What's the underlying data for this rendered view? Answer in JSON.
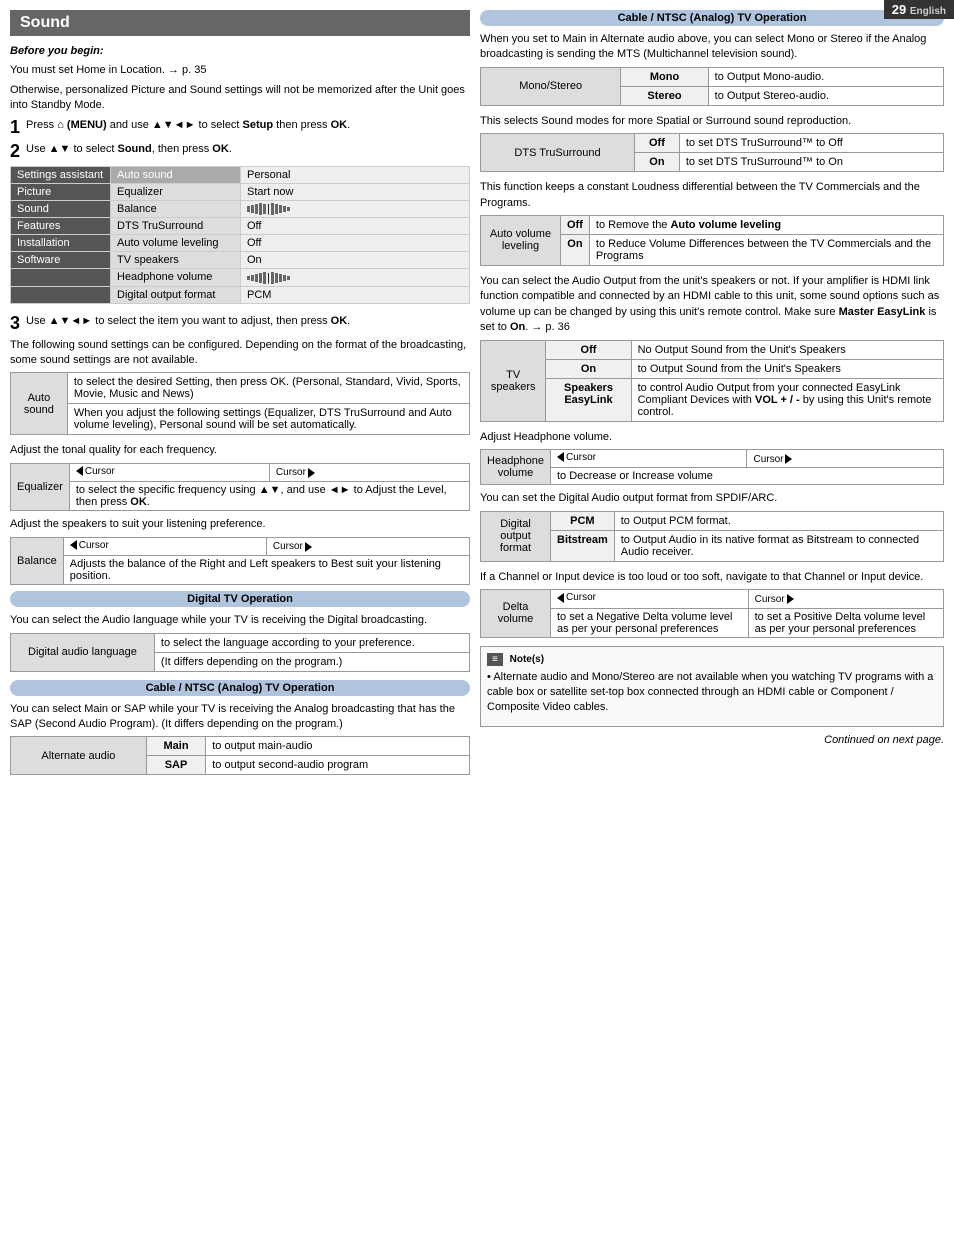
{
  "page": {
    "number": "29",
    "language": "English"
  },
  "left": {
    "heading": "Sound",
    "before_begin": "Before you begin:",
    "setup_note": "You must set Home in Location. → p. 35",
    "memorize_note": "Otherwise, personalized Picture and Sound settings will not be memorized after the Unit goes into Standby Mode.",
    "step1": "Press  (MENU) and use ▲▼◄► to select Setup then press OK.",
    "step2": "Use ▲▼ to select Sound, then press OK.",
    "settings_table": {
      "col1_header": "Settings assistant",
      "col2_header": "Auto sound",
      "col3_header": "Personal",
      "rows": [
        {
          "nav": "Picture",
          "item": "Equalizer",
          "value": "Start now"
        },
        {
          "nav": "Sound",
          "item": "Balance",
          "value": "bar"
        },
        {
          "nav": "Features",
          "item": "DTS TruSurround",
          "value": "Off"
        },
        {
          "nav": "Installation",
          "item": "Auto volume leveling",
          "value": "Off"
        },
        {
          "nav": "Software",
          "item": "TV speakers",
          "value": "On"
        },
        {
          "nav": "",
          "item": "Headphone volume",
          "value": "bar"
        },
        {
          "nav": "",
          "item": "Digital output format",
          "value": "PCM"
        }
      ]
    },
    "step3": "Use ▲▼◄► to select the item you want to adjust, then press OK.",
    "step3_note": "The following sound settings can be configured. Depending on the format of the broadcasting, some sound settings are not available.",
    "auto_sound": {
      "label": "Auto sound",
      "desc1": "to select the desired Setting, then press OK. (Personal, Standard, Vivid, Sports, Movie, Music and News)",
      "desc2": "When you adjust the following settings (Equalizer, DTS TruSurround and Auto volume leveling), Personal sound will be set automatically."
    },
    "equalizer_intro": "Adjust the tonal quality for each frequency.",
    "equalizer": {
      "label": "Equalizer",
      "cursor_left": "◄ Cursor",
      "cursor_right": "Cursor ►",
      "desc": "to select the specific frequency using ▲▼, and use ◄► to Adjust the Level, then press OK."
    },
    "balance_intro": "Adjust the speakers to suit your listening preference.",
    "balance": {
      "label": "Balance",
      "cursor_left": "◄ Cursor",
      "cursor_right": "Cursor ►",
      "desc": "Adjusts the balance of the Right and Left speakers to Best suit your listening position."
    },
    "digital_tv_banner": "Digital TV Operation",
    "digital_tv_intro": "You can select the Audio language while your TV is receiving the Digital broadcasting.",
    "digital_audio": {
      "label": "Digital audio language",
      "desc1": "to select the language according to your preference.",
      "desc2": "(It differs depending on the program.)"
    },
    "cable_banner1": "Cable / NTSC (Analog) TV Operation",
    "cable_intro": "You can select Main or SAP while your TV is receiving the Analog broadcasting that has the SAP (Second Audio Program). (It differs depending on the program.)",
    "alternate_audio": {
      "label": "Alternate audio",
      "rows": [
        {
          "key": "Main",
          "desc": "to output main-audio"
        },
        {
          "key": "SAP",
          "desc": "to output second-audio program"
        }
      ]
    }
  },
  "right": {
    "cable_banner": "Cable / NTSC (Analog) TV Operation",
    "mono_stereo_intro": "When you set to Main in Alternate audio above, you can select Mono or Stereo if the Analog broadcasting is sending the MTS (Multichannel television sound).",
    "mono_stereo": {
      "label": "Mono/Stereo",
      "rows": [
        {
          "key": "Mono",
          "desc": "to Output Mono-audio."
        },
        {
          "key": "Stereo",
          "desc": "to Output Stereo-audio."
        }
      ]
    },
    "dts_intro": "This selects Sound modes for more Spatial or Surround sound reproduction.",
    "dts_trusurround": {
      "label": "DTS TruSurround",
      "rows": [
        {
          "key": "Off",
          "desc": "to set DTS TruSurround™ to Off"
        },
        {
          "key": "On",
          "desc": "to set DTS TruSurround™ to On"
        }
      ]
    },
    "auto_volume_intro": "This function keeps a constant Loudness differential between the TV Commercials and the Programs.",
    "auto_volume": {
      "label": "Auto volume leveling",
      "rows": [
        {
          "key": "Off",
          "desc": "to Remove the Auto volume leveling"
        },
        {
          "key": "On",
          "desc": "to Reduce Volume Differences between the TV Commercials and the Programs"
        }
      ]
    },
    "tv_speakers_intro": "You can select the Audio Output from the unit's speakers or not. If your amplifier is HDMI link function compatible and connected by an HDMI cable to this unit, some sound options such as volume up can be changed by using this unit's remote control. Make sure Master EasyLink is set to On. → p. 36",
    "tv_speakers": {
      "label": "TV speakers",
      "rows": [
        {
          "key": "Off",
          "desc": "No Output Sound from the Unit's Speakers"
        },
        {
          "key": "On",
          "desc": "to Output Sound from the Unit's Speakers"
        },
        {
          "key": "Speakers EasyLink",
          "desc": "to control Audio Output from your connected EasyLink Compliant Devices with VOL + / - by using this Unit's remote control."
        }
      ]
    },
    "headphone_intro": "Adjust Headphone volume.",
    "headphone": {
      "label": "Headphone volume",
      "cursor_left": "◄ Cursor",
      "cursor_right": "Cursor ►",
      "desc": "to Decrease or Increase volume"
    },
    "digital_output_intro": "You can set the Digital Audio output format from SPDIF/ARC.",
    "digital_output": {
      "label": "Digital output format",
      "rows": [
        {
          "key": "PCM",
          "desc": "to Output PCM format."
        },
        {
          "key": "Bitstream",
          "desc": "to Output Audio in its native format as Bitstream to connected Audio receiver."
        }
      ]
    },
    "delta_intro": "If a Channel or Input device is too loud or too soft, navigate to that Channel or Input device.",
    "delta_volume": {
      "label": "Delta volume",
      "cursor_left": "◄ Cursor",
      "cursor_right": "Cursor ►",
      "desc_left": "to set a Negative Delta volume level as per your personal preferences",
      "desc_right": "to set a Positive Delta volume level as per your personal preferences"
    },
    "note_label": "Note(s)",
    "note_text": "Alternate audio and Mono/Stereo are not available when you watching TV programs with a cable box or satellite set-top box connected through an HDMI cable or Component / Composite Video cables.",
    "continued": "Continued on next page."
  }
}
